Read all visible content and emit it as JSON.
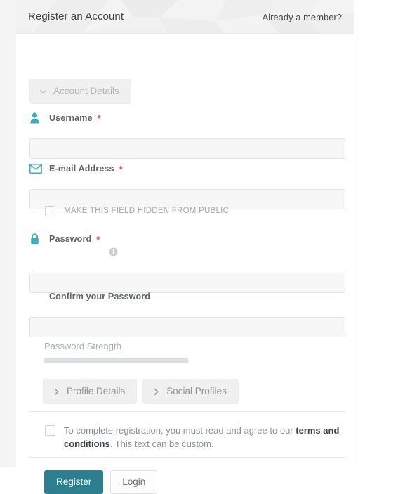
{
  "theme": {
    "accent_teal": "#2b7f8e",
    "icon_teal": "#3fa9bd",
    "required_red": "#e8413c",
    "muted_gray": "#a6a6a6",
    "input_bg": "#f7f7f7",
    "header_bg": "#efefef"
  },
  "header": {
    "title": "Register an Account",
    "member_link": "Already a member?"
  },
  "accordion": {
    "account_details": {
      "label": "Account Details",
      "icon": "chevron-down-icon",
      "expanded": true
    },
    "profile_details": {
      "label": "Profile Details",
      "icon": "chevron-right-icon",
      "expanded": false
    },
    "social_profiles": {
      "label": "Social Profiles",
      "icon": "chevron-right-icon",
      "expanded": false
    }
  },
  "fields": {
    "username": {
      "label": "Username",
      "required_marker": "*",
      "icon": "user-icon",
      "value": "",
      "placeholder": ""
    },
    "email": {
      "label": "E-mail Address",
      "required_marker": "*",
      "icon": "envelope-icon",
      "value": "",
      "placeholder": "",
      "hidden_checkbox_label": "MAKE THIS FIELD HIDDEN FROM PUBLIC",
      "hidden_checkbox_checked": false
    },
    "password": {
      "label": "Password",
      "required_marker": "*",
      "icon": "lock-icon",
      "info_icon": "info-icon",
      "value": "",
      "placeholder": ""
    },
    "confirm_password": {
      "label": "Confirm your Password",
      "value": "",
      "placeholder": ""
    }
  },
  "password_strength": {
    "label": "Password Strength",
    "bar_percent": 45,
    "bar_color": "#dcdfe1"
  },
  "terms": {
    "checked": false,
    "text_before": "To complete registration, you must read and agree to our ",
    "link_text": "terms and conditions",
    "text_after": ". This text can be custom."
  },
  "actions": {
    "register_label": "Register",
    "login_label": "Login"
  }
}
